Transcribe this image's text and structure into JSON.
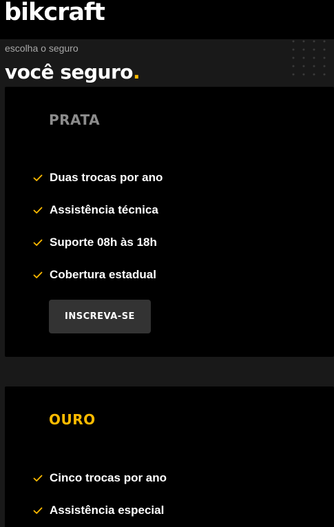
{
  "header": {
    "logo": "bikcraft"
  },
  "pricing": {
    "subtitle": "escolha o seguro",
    "title": "você seguro",
    "title_dot": ".",
    "accent_color": "#ffbb00",
    "plans": [
      {
        "name": "PRATA",
        "features": [
          "Duas trocas por ano",
          "Assistência técnica",
          "Suporte 08h às 18h",
          "Cobertura estadual"
        ],
        "button_label": "INSCREVA-SE"
      },
      {
        "name": "OURO",
        "features": [
          "Cinco trocas por ano",
          "Assistência especial"
        ]
      }
    ]
  }
}
